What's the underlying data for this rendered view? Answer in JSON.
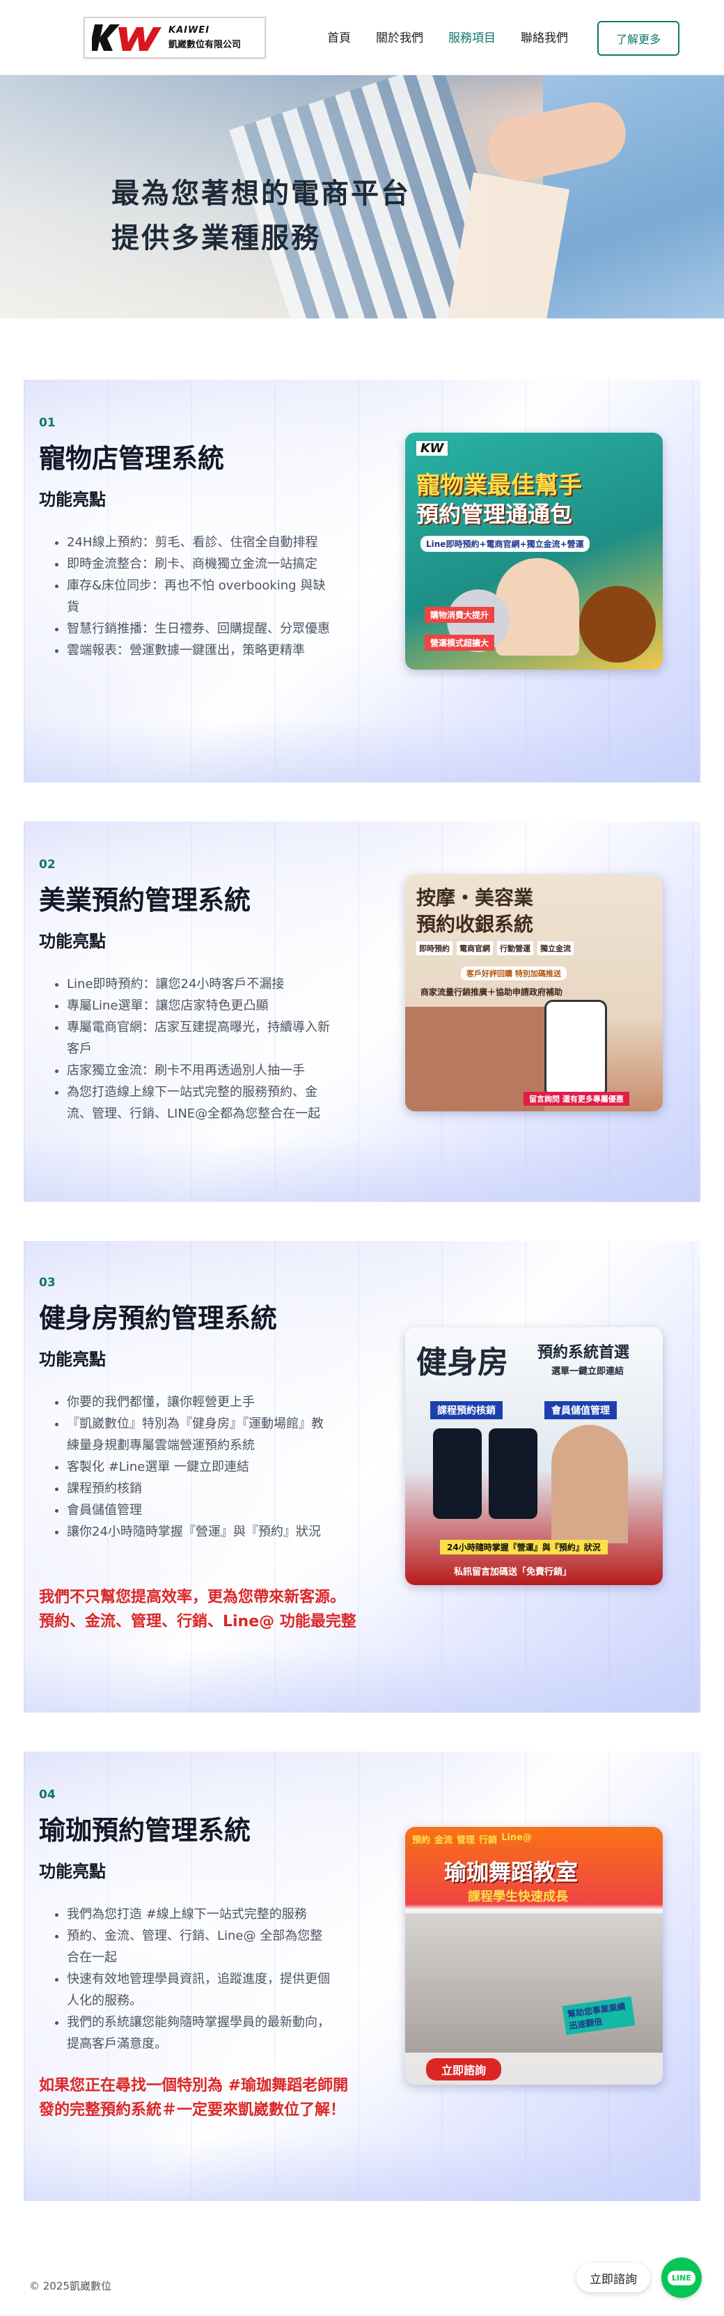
{
  "nav": {
    "logo_en": "KAIWEI",
    "logo_zh": "凱崴數位有限公司",
    "menu": [
      "首頁",
      "關於我們",
      "服務項目",
      "聯絡我們"
    ],
    "cta": "了解更多"
  },
  "hero": {
    "line1": "最為您著想的電商平台",
    "line2": "提供多業種服務"
  },
  "sections": [
    {
      "num": "01",
      "title": "寵物店管理系統",
      "sub": "功能亮點",
      "items": [
        "24H線上預約：剪毛、看診、住宿全自動排程",
        "即時金流整合：刷卡、商機獨立金流一站搞定",
        "庫存&床位同步：再也不怕 overbooking 與缺貨",
        "智慧行銷推播：生日禮券、回購提醒、分眾優惠",
        "雲端報表：營運數據一鍵匯出，策略更精準"
      ],
      "card": {
        "brand": "KW",
        "line1": "寵物業最佳幫手",
        "line2": "預約管理通通包",
        "line3": "Line即時預約+電商官網+獨立金流+營運",
        "tag1": "購物消費大提升",
        "tag2": "營運模式超擴大"
      }
    },
    {
      "num": "02",
      "title": "美業預約管理系統",
      "sub": "功能亮點",
      "items": [
        "Line即時預約：讓您24小時客戶不漏接",
        "專屬Line選單：讓您店家特色更凸顯",
        "專屬電商官網：店家互建提高曝光，持續導入新客戶",
        "店家獨立金流：刷卡不用再透過別人抽一手",
        "為您打造線上線下一站式完整的服務預約、金流、管理、行銷、LINE@全都為您整合在一起"
      ],
      "card": {
        "line1": "按摩・美容業",
        "line2": "預約收銀系統",
        "checks": [
          "即時預約",
          "電商官網",
          "行動營運",
          "獨立金流"
        ],
        "line3": "客戶好評回購 特別加碼推送",
        "line4": "商家流量行銷推廣＋協助申請政府補助",
        "line5": "留言詢問 還有更多專屬優惠"
      }
    },
    {
      "num": "03",
      "title": "健身房預約管理系統",
      "sub": "功能亮點",
      "items": [
        "你要的我們都懂，讓你輕營更上手",
        "『凱崴數位』特別為『健身房』『運動場館』教練量身規劃專屬雲端營運預約系統",
        "客製化 #Line選單 一鍵立即連結",
        "課程預約核銷",
        "會員儲值管理",
        "讓你24小時隨時掌握『營運』與『預約』狀況"
      ],
      "note": "我們不只幫您提高效率，更為您帶來新客源。 預約、金流、管理、行銷、Line@ 功能最完整",
      "card": {
        "line1": "健身房",
        "line2": "預約系統首選",
        "line3": "選單一鍵立即連結",
        "tag1": "課程預約核銷",
        "tag2": "會員儲值管理",
        "line4": "24小時隨時掌握『營運』與『預約』狀況",
        "line5": "私訊留言加碼送「免費行銷」"
      }
    },
    {
      "num": "04",
      "title": "瑜珈預約管理系統",
      "sub": "功能亮點",
      "items": [
        "我們為您打造 #線上線下一站式完整的服務",
        "預約、金流、管理、行銷、Line@ 全部為您整合在一起",
        "快速有效地管理學員資訊，追蹤進度，提供更個人化的服務。",
        "我們的系統讓您能夠隨時掌握學員的最新動向，提高客戶滿意度。"
      ],
      "note": "如果您正在尋找一個特別為 #瑜珈舞蹈老師開發的完整預約系統＃一定要來凱崴數位了解！",
      "card": {
        "checks": [
          "預約",
          "金流",
          "管理",
          "行銷",
          "Line@"
        ],
        "line1": "瑜珈舞蹈教室",
        "line2": "課程學生快速成長",
        "line3": "幫助您事業業績迅速翻倍",
        "line4": "立即諮詢"
      }
    }
  ],
  "footer": {
    "copyright": "© 2025凱崴數位",
    "chat": "立即諮詢",
    "line_badge": "LINE"
  },
  "colors": {
    "accent": "#0f766e",
    "note_red": "#dc2626",
    "line_green": "#06c755"
  }
}
